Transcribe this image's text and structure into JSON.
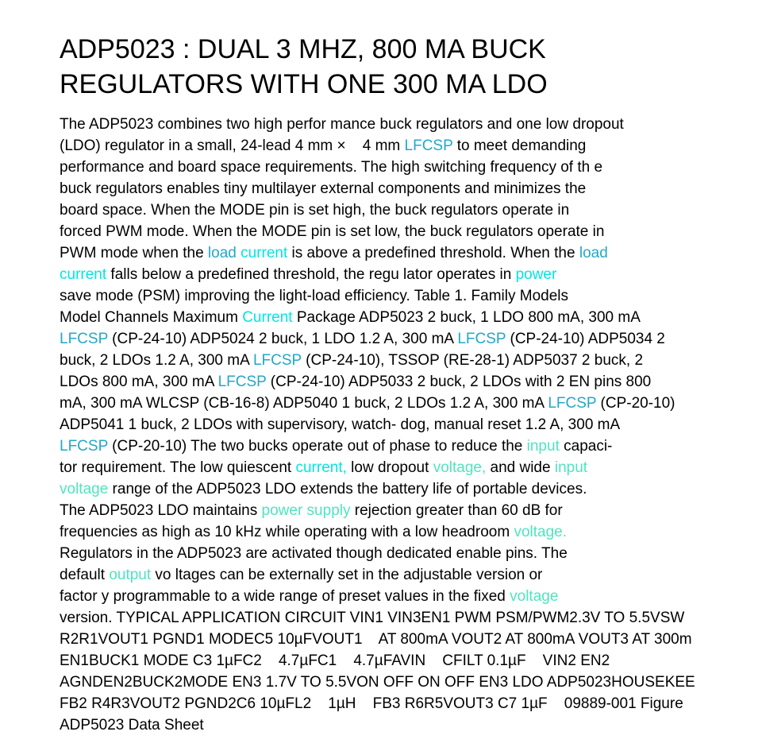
{
  "title": {
    "line1": "ADP5023 : DUAL 3 MHZ, 800 MA BUCK",
    "line2": "REGULATORS WITH ONE 300 MA LDO"
  },
  "colors": {
    "text": "#000000",
    "link_blue": "#22a8c8",
    "link_cyan": "#00e5e5",
    "link_mint": "#4fe4c0"
  },
  "lines": [
    [
      {
        "t": "The ADP5023 combines two high perfor mance buck regulators and one low dropout"
      }
    ],
    [
      {
        "t": "(LDO) regulator in a small, 24-lead 4 mm ×    4 mm "
      },
      {
        "t": "LFCSP",
        "c": "link_blue"
      },
      {
        "t": " to meet demanding"
      }
    ],
    [
      {
        "t": "performance and board space requirements. The high switching frequency of th e"
      }
    ],
    [
      {
        "t": "buck regulators enables tiny multilayer external components and minimizes the"
      }
    ],
    [
      {
        "t": "board space. When the MODE pin is set high, the buck regulators operate in"
      }
    ],
    [
      {
        "t": "forced PWM mode. When the MODE pin is set low, the buck regulators operate in"
      }
    ],
    [
      {
        "t": "PWM mode when the "
      },
      {
        "t": "load",
        "c": "link_blue"
      },
      {
        "t": " current",
        "c": "link_cyan"
      },
      {
        "t": " is above a predefined threshold. When the "
      },
      {
        "t": "load",
        "c": "link_blue"
      }
    ],
    [
      {
        "t": "current",
        "c": "link_cyan"
      },
      {
        "t": " falls below a predefined threshold, the regu lator operates in "
      },
      {
        "t": "power",
        "c": "link_cyan"
      }
    ],
    [
      {
        "t": "save mode (PSM) improving the light-load efficiency. Table 1. Family Models"
      }
    ],
    [
      {
        "t": "Model Channels Maximum "
      },
      {
        "t": "Current",
        "c": "link_cyan"
      },
      {
        "t": " Package ADP5023 2 buck, 1 LDO 800 mA, 300 mA"
      }
    ],
    [
      {
        "t": "LFCSP",
        "c": "link_blue"
      },
      {
        "t": " (CP-24-10) ADP5024 2 buck, 1 LDO 1.2 A, 300 mA "
      },
      {
        "t": "LFCSP",
        "c": "link_blue"
      },
      {
        "t": " (CP-24-10) ADP5034 2"
      }
    ],
    [
      {
        "t": "buck, 2 LDOs 1.2 A, 300 mA "
      },
      {
        "t": "LFCSP",
        "c": "link_blue"
      },
      {
        "t": " (CP-24-10), TSSOP (RE-28-1) ADP5037 2 buck, 2"
      }
    ],
    [
      {
        "t": "LDOs 800 mA, 300 mA "
      },
      {
        "t": "LFCSP",
        "c": "link_blue"
      },
      {
        "t": " (CP-24-10) ADP5033 2 buck, 2 LDOs with 2 EN pins 800"
      }
    ],
    [
      {
        "t": "mA, 300 mA WLCSP (CB-16-8) ADP5040 1 buck, 2 LDOs 1.2 A, 300 mA "
      },
      {
        "t": "LFCSP",
        "c": "link_blue"
      },
      {
        "t": " (CP-20-10)"
      }
    ],
    [
      {
        "t": "ADP5041 1 buck, 2 LDOs with supervisory, watch- dog, manual reset 1.2 A, 300 mA"
      }
    ],
    [
      {
        "t": "LFCSP",
        "c": "link_blue"
      },
      {
        "t": " (CP-20-10) The two bucks operate out of phase to reduce the "
      },
      {
        "t": "input",
        "c": "link_mint"
      },
      {
        "t": " capaci-"
      }
    ],
    [
      {
        "t": "tor requirement. The low quiescent "
      },
      {
        "t": "current,",
        "c": "link_cyan"
      },
      {
        "t": " low dropout "
      },
      {
        "t": "voltage,",
        "c": "link_mint"
      },
      {
        "t": " and wide "
      },
      {
        "t": "input",
        "c": "link_mint"
      }
    ],
    [
      {
        "t": "voltage",
        "c": "link_mint"
      },
      {
        "t": " range of the ADP5023 LDO extends the battery life of portable devices."
      }
    ],
    [
      {
        "t": "The ADP5023 LDO maintains "
      },
      {
        "t": "power supply",
        "c": "link_mint"
      },
      {
        "t": " rejection greater than 60 dB for"
      }
    ],
    [
      {
        "t": "frequencies as high as 10 kHz while operating with a low headroom "
      },
      {
        "t": "voltage.",
        "c": "link_mint"
      }
    ],
    [
      {
        "t": "Regulators in the ADP5023 are activated though dedicated enable pins. The"
      }
    ],
    [
      {
        "t": "default "
      },
      {
        "t": "output",
        "c": "link_mint"
      },
      {
        "t": " vo ltages can be externally set in the adjustable version or"
      }
    ],
    [
      {
        "t": "factor y programmable to a wide range of preset values in the fixed "
      },
      {
        "t": "voltage",
        "c": "link_mint"
      }
    ],
    [
      {
        "t": "version. TYPICAL APPLICATION CIRCUIT VIN1 VIN3EN1 PWM PSM/PWM2.3V TO 5.5VSW"
      }
    ],
    [
      {
        "t": "R2R1VOUT1 PGND1 MODEC5 10µFVOUT1    AT 800mA VOUT2 AT 800mA VOUT3 AT 300m"
      }
    ],
    [
      {
        "t": "EN1BUCK1 MODE C3 1µFC2    4.7µFC1    4.7µFAVIN    CFILT 0.1µF    VIN2 EN2"
      }
    ],
    [
      {
        "t": "AGNDEN2BUCK2MODE EN3 1.7V TO 5.5VON OFF ON OFF EN3 LDO ADP5023HOUSEKEE"
      }
    ],
    [
      {
        "t": "FB2 R4R3VOUT2 PGND2C6 10µFL2    1µH    FB3 R6R5VOUT3 C7 1µF    09889-001 Figure"
      }
    ],
    [
      {
        "t": "ADP5023 Data Sheet"
      }
    ]
  ]
}
